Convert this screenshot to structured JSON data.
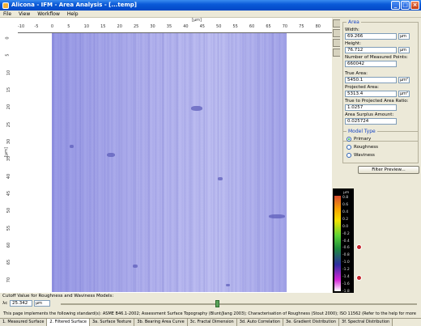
{
  "window": {
    "title": "Alicona - IFM - Area Analysis - [...temp]",
    "buttons": [
      "_",
      "□",
      "×"
    ]
  },
  "menu": [
    "File",
    "View",
    "Workflow",
    "Help"
  ],
  "ruler": {
    "unit_top": "[μm]",
    "unit_left": "[μm]",
    "top_ticks": [
      "-10",
      "-5",
      "0",
      "5",
      "10",
      "15",
      "20",
      "25",
      "30",
      "35",
      "40",
      "45",
      "50",
      "55",
      "60",
      "65",
      "70",
      "75",
      "80"
    ],
    "left_ticks": [
      "0",
      "5",
      "10",
      "15",
      "20",
      "25",
      "30",
      "35",
      "40",
      "45",
      "50",
      "55",
      "60",
      "65",
      "70"
    ]
  },
  "area_panel": {
    "title": "Area",
    "width_label": "Width:",
    "width_value": "69.266",
    "width_unit": "μm",
    "height_label": "Height:",
    "height_value": "76.712",
    "height_unit": "μm",
    "points_label": "Number of Measured Points:",
    "points_value": "660042",
    "true_area_label": "True Area:",
    "true_area_value": "5450.1",
    "true_area_unit": "μm²",
    "projected_area_label": "Projected Area:",
    "projected_area_value": "5313.4",
    "projected_area_unit": "μm²",
    "ratio_label": "True to Projected Area Ratio:",
    "ratio_value": "1.0257",
    "surplus_label": "Area Surplus Amount:",
    "surplus_value": "0.025724"
  },
  "model_panel": {
    "title": "Model Type",
    "options": [
      "Primary",
      "Roughness",
      "Waviness"
    ],
    "selected": 0,
    "filter_button": "Filter Preview..."
  },
  "colorbar": {
    "unit": "μm",
    "labels": [
      "0.8",
      "0.6",
      "0.4",
      "0.2",
      "0.0",
      "-0.2",
      "-0.4",
      "-0.6",
      "-0.8",
      "-1.0",
      "-1.2",
      "-1.4",
      "-1.6",
      "-1.8"
    ]
  },
  "cutoff": {
    "label": "Cutoff Value for Roughness and Waviness Models:",
    "prefix": "λc",
    "value": "25.342",
    "unit": "μm"
  },
  "status_text": "This page implements the following standard(s): ASME B46.1-2002; Assessment Surface Topography (Blunt/Jiang 2003); Characterisation of Roughness (Stout 2000); ISO 11562 (Refer to the help for more information)",
  "tabs": [
    "1. Measured Surface",
    "2. Filtered Surface",
    "3a. Surface Texture",
    "3b. Bearing Area Curve",
    "3c. Fractal Dimension",
    "3d. Auto Correlation",
    "3e. Gradient Distribution",
    "3f. Spectral Distribution"
  ],
  "active_tab": 1
}
